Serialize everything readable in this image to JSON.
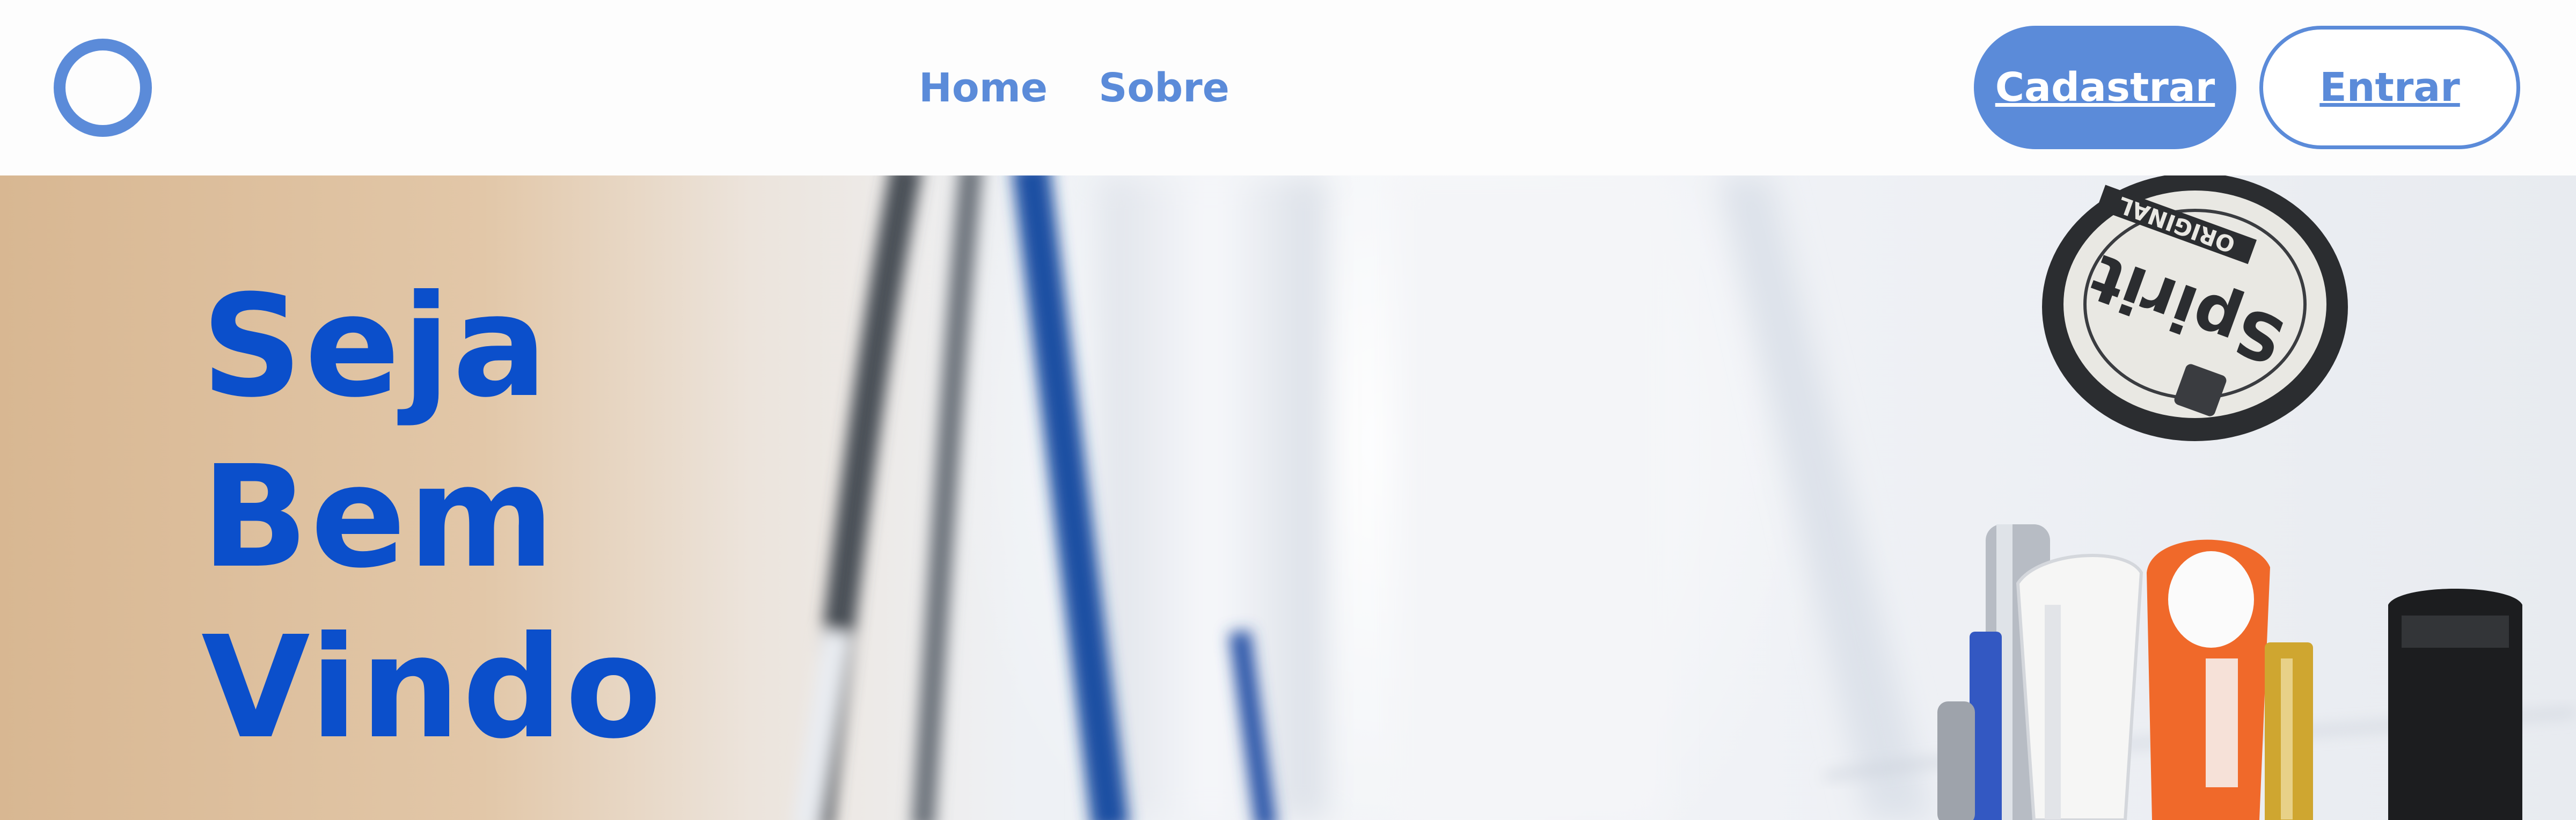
{
  "header": {
    "logo_icon": "ring-logo-icon",
    "nav": [
      {
        "label": "Home"
      },
      {
        "label": "Sobre"
      }
    ],
    "signup_label": "Cadastrar",
    "login_label": "Entrar"
  },
  "hero": {
    "title_lines": [
      "Seja",
      "Bem",
      "Vindo"
    ],
    "image": "doctor-coat-with-stethoscope-and-pens-photo",
    "badge_text": "Spirit",
    "badge_subtext": "ORIGINAL"
  },
  "colors": {
    "accent": "#5b8bd9",
    "hero_title": "#0b4fcb",
    "background": "#fdfdfd"
  }
}
